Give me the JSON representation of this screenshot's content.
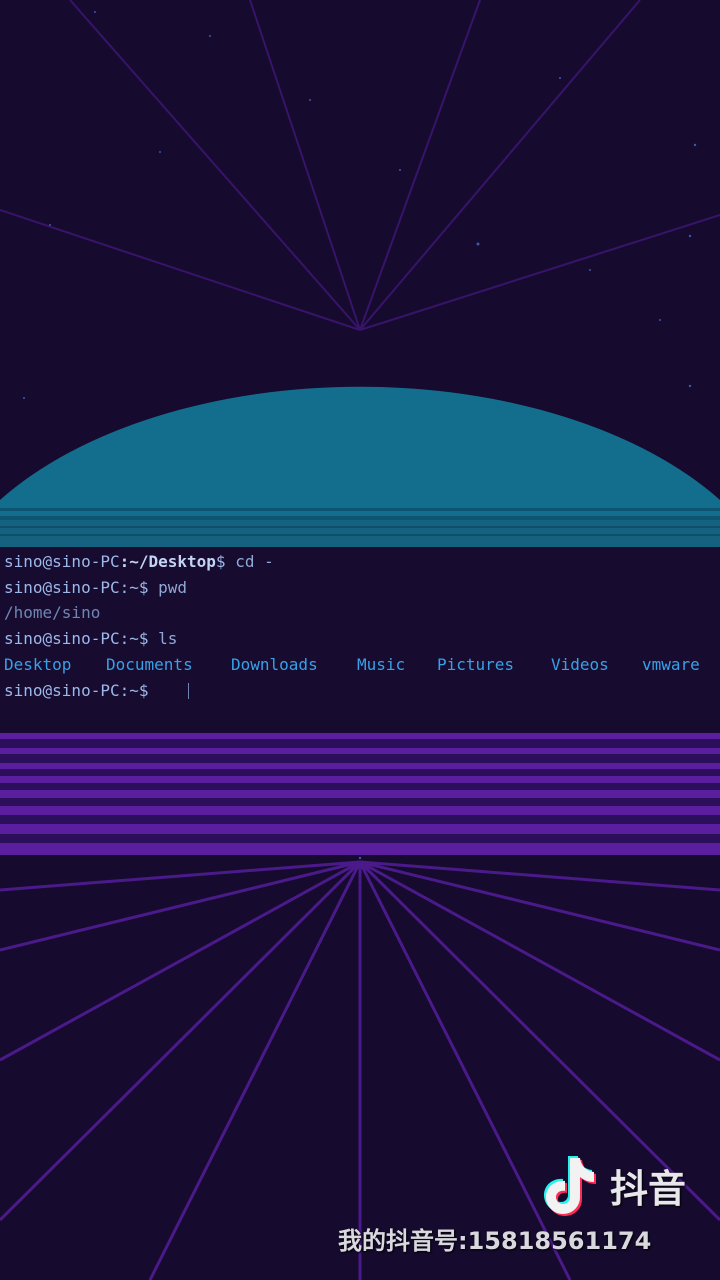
{
  "terminal": {
    "line1": {
      "user": "sino@sino-PC",
      "path": ":~/Desktop",
      "prompt": "$ ",
      "command": "cd -"
    },
    "line2": {
      "user": "sino@sino-PC",
      "path": ":~",
      "prompt": "$ ",
      "command": "pwd"
    },
    "line3": {
      "output": "/home/sino"
    },
    "line4": {
      "user": "sino@sino-PC",
      "path": ":~",
      "prompt": "$ ",
      "command": "ls"
    },
    "ls_output": [
      "Desktop",
      "Documents",
      "Downloads",
      "Music",
      "Pictures",
      "Videos",
      "vmware"
    ],
    "line6": {
      "user": "sino@sino-PC",
      "path": ":~",
      "prompt": "$ "
    }
  },
  "watermark": {
    "text": "我的抖音号:15818561174",
    "brand_name": "抖音",
    "brand_logo_icon": "douyin-note-icon"
  },
  "colors": {
    "background": "#160b2e",
    "sun": "#136e8e",
    "rays": "#4a1a8a",
    "grid_lines": "#5a1e9e",
    "ls_blue": "#38a0e8"
  }
}
